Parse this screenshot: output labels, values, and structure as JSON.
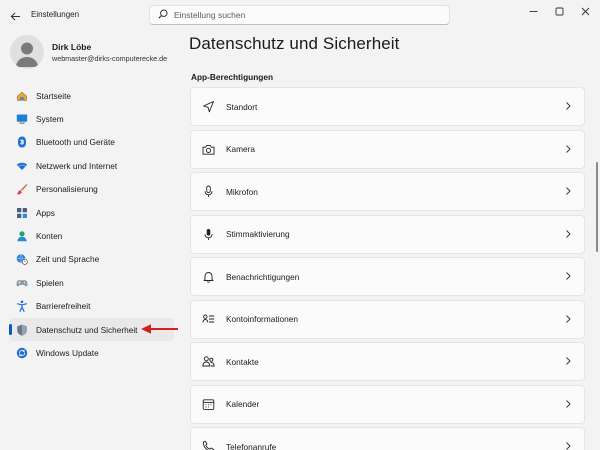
{
  "titlebar": {
    "app_title": "Einstellungen",
    "back_icon": "arrow-left-icon",
    "minimize_icon": "minimize-icon",
    "maximize_icon": "maximize-icon",
    "close_icon": "close-icon"
  },
  "search": {
    "placeholder": "Einstellung suchen",
    "value": ""
  },
  "profile": {
    "name": "Dirk Löbe",
    "email": "webmaster@dirks-computerecke.de"
  },
  "sidebar": {
    "items": [
      {
        "label": "Startseite",
        "icon": "home-icon"
      },
      {
        "label": "System",
        "icon": "monitor-icon"
      },
      {
        "label": "Bluetooth und Geräte",
        "icon": "bluetooth-icon"
      },
      {
        "label": "Netzwerk und Internet",
        "icon": "wifi-icon"
      },
      {
        "label": "Personalisierung",
        "icon": "brush-icon"
      },
      {
        "label": "Apps",
        "icon": "apps-icon"
      },
      {
        "label": "Konten",
        "icon": "person-icon"
      },
      {
        "label": "Zeit und Sprache",
        "icon": "globe-clock-icon"
      },
      {
        "label": "Spielen",
        "icon": "gamepad-icon"
      },
      {
        "label": "Barrierefreiheit",
        "icon": "accessibility-icon"
      },
      {
        "label": "Datenschutz und Sicherheit",
        "icon": "shield-icon",
        "active": true
      },
      {
        "label": "Windows Update",
        "icon": "update-icon"
      }
    ]
  },
  "main": {
    "title": "Datenschutz und Sicherheit",
    "section": "App-Berechtigungen",
    "items": [
      {
        "label": "Standort",
        "icon": "location-icon"
      },
      {
        "label": "Kamera",
        "icon": "camera-icon"
      },
      {
        "label": "Mikrofon",
        "icon": "microphone-icon"
      },
      {
        "label": "Stimmaktivierung",
        "icon": "voice-activation-icon"
      },
      {
        "label": "Benachrichtigungen",
        "icon": "bell-icon"
      },
      {
        "label": "Kontoinformationen",
        "icon": "account-info-icon"
      },
      {
        "label": "Kontakte",
        "icon": "contacts-icon"
      },
      {
        "label": "Kalender",
        "icon": "calendar-icon"
      },
      {
        "label": "Telefonanrufe",
        "icon": "phone-icon"
      }
    ]
  },
  "colors": {
    "accent": "#005fb8",
    "annotation_arrow": "#d6201e",
    "background": "#f3f3f3",
    "card": "#fbfbfb"
  }
}
